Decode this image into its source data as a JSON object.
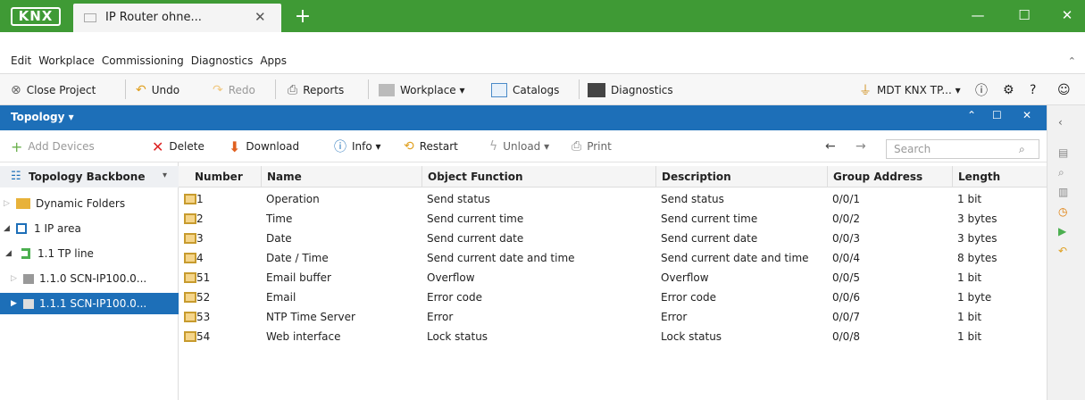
{
  "titlebar": {
    "logo": "KNX",
    "tab_title": "IP Router ohne...",
    "new_tab": "+",
    "minimize": "—",
    "maximize": "☐",
    "close": "✕"
  },
  "menu": [
    "Edit",
    "Workplace",
    "Commissioning",
    "Diagnostics",
    "Apps"
  ],
  "toolbar": {
    "close_project": "Close Project",
    "undo": "Undo",
    "redo": "Redo",
    "reports": "Reports",
    "workplace": "Workplace ▾",
    "catalogs": "Catalogs",
    "diagnostics": "Diagnostics",
    "interface": "MDT KNX TP... ▾"
  },
  "panel": {
    "title": "Topology ▾"
  },
  "panel_toolbar": {
    "add_devices": "Add Devices",
    "delete": "Delete",
    "download": "Download",
    "info": "Info ▾",
    "restart": "Restart",
    "unload": "Unload ▾",
    "print": "Print",
    "search_placeholder": "Search"
  },
  "sidebar": {
    "header": "Topology Backbone",
    "items": [
      {
        "label": "Dynamic Folders"
      },
      {
        "label": "1 IP area"
      },
      {
        "label": "1.1 TP line"
      },
      {
        "label": "1.1.0 SCN-IP100.0..."
      },
      {
        "label": "1.1.1 SCN-IP100.0..."
      }
    ]
  },
  "table": {
    "columns": [
      "Number",
      "Name",
      "Object Function",
      "Description",
      "Group Address",
      "Length"
    ],
    "rows": [
      {
        "number": "1",
        "name": "Operation",
        "function": "Send status",
        "description": "Send status",
        "group": "0/0/1",
        "length": "1 bit"
      },
      {
        "number": "2",
        "name": "Time",
        "function": "Send current time",
        "description": "Send current time",
        "group": "0/0/2",
        "length": "3 bytes"
      },
      {
        "number": "3",
        "name": "Date",
        "function": "Send current date",
        "description": "Send current date",
        "group": "0/0/3",
        "length": "3 bytes"
      },
      {
        "number": "4",
        "name": "Date / Time",
        "function": "Send current date and time",
        "description": "Send current date and time",
        "group": "0/0/4",
        "length": "8 bytes"
      },
      {
        "number": "51",
        "name": "Email buffer",
        "function": "Overflow",
        "description": "Overflow",
        "group": "0/0/5",
        "length": "1 bit"
      },
      {
        "number": "52",
        "name": "Email",
        "function": "Error code",
        "description": "Error code",
        "group": "0/0/6",
        "length": "1 byte"
      },
      {
        "number": "53",
        "name": "NTP Time Server",
        "function": "Error",
        "description": "Error",
        "group": "0/0/7",
        "length": "1 bit"
      },
      {
        "number": "54",
        "name": "Web interface",
        "function": "Lock status",
        "description": "Lock status",
        "group": "0/0/8",
        "length": "1 bit"
      }
    ]
  },
  "colors": {
    "titlebar": "#3f9a35",
    "panel_header": "#1d6fb8",
    "selection": "#1d6fb8"
  }
}
